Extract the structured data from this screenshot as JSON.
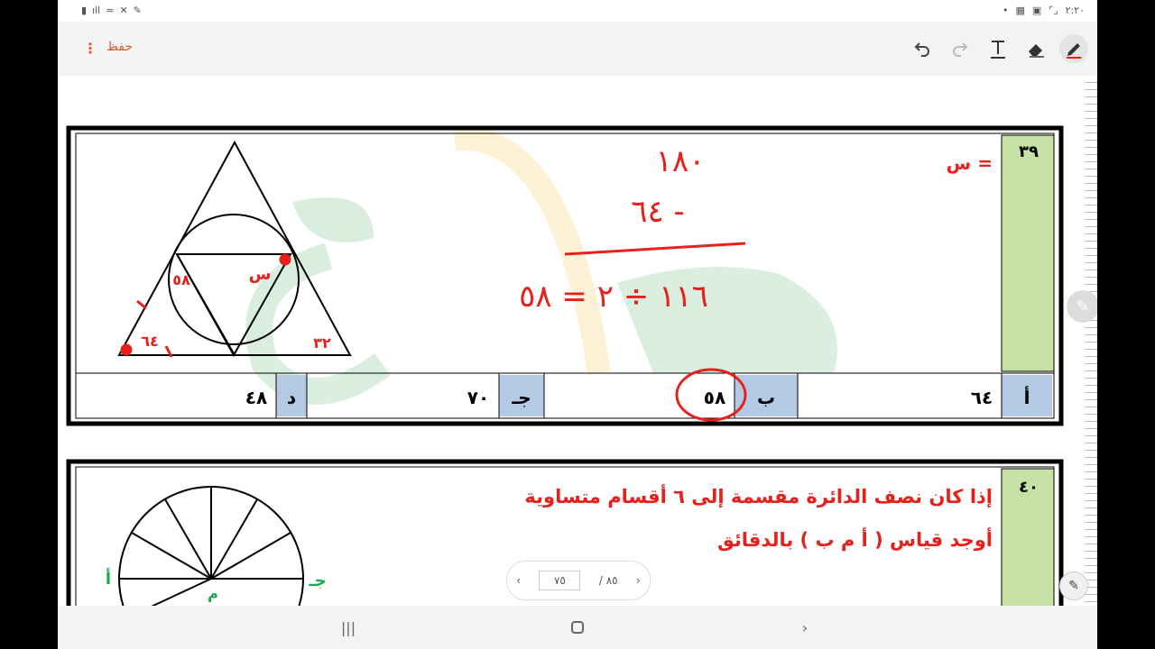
{
  "status_bar": {
    "time": "٢:٢٠"
  },
  "toolbar": {
    "save_label": "حفظ"
  },
  "question_39": {
    "number": "٣٩",
    "question_text": "س =",
    "figure": {
      "labels_red": [
        "٥٨",
        "س",
        "٣٢",
        "٦٤"
      ],
      "handwritten": [
        "١٨٠",
        "٦٤ -",
        "١١٦ ÷ ٢ = ٥٨"
      ]
    },
    "options": [
      {
        "letter": "أ",
        "value": "٦٤"
      },
      {
        "letter": "ب",
        "value": "٥٨"
      },
      {
        "letter": "جـ",
        "value": "٧٠"
      },
      {
        "letter": "د",
        "value": "٤٨"
      }
    ],
    "circled_option": "ب"
  },
  "question_40": {
    "number": "٤٠",
    "line1": "إذا كان نصف الدائرة مقسمة إلى ٦ أقسام متساوية",
    "line2": "أوجد قياس ( أ م ب ) بالدقائق",
    "labels_green": [
      "أ",
      "م",
      "جـ"
    ]
  },
  "pager": {
    "current": "٧٥",
    "total": "/ ٨٥"
  },
  "colors": {
    "red": "#e8201b",
    "green_cell": "#c5e1a5",
    "blue_cell": "#b4c9e3",
    "accent": "#e0582e",
    "green_label": "#19a84a"
  }
}
